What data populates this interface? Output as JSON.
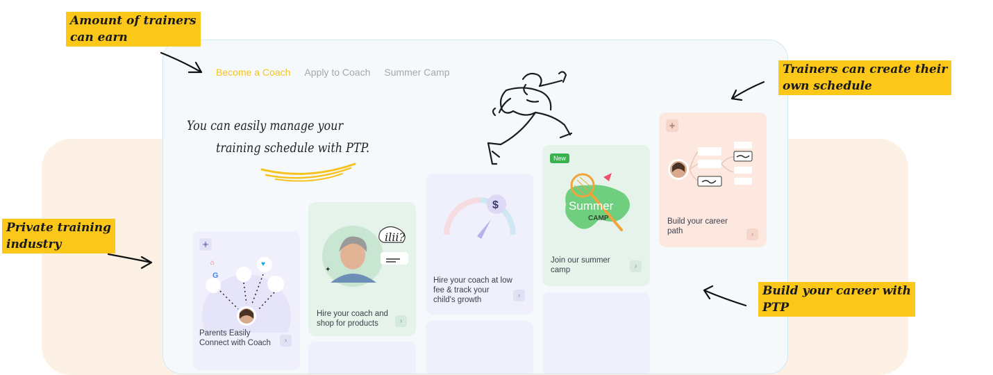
{
  "nav": {
    "items": [
      {
        "label": "Become a Coach",
        "active": true
      },
      {
        "label": "Apply to Coach",
        "active": false
      },
      {
        "label": "Summer Camp",
        "active": false
      }
    ]
  },
  "hero": {
    "line1": "You can easily manage your",
    "line2": "training schedule with PTP."
  },
  "cards": {
    "connect": {
      "label_line1": "Parents Easily",
      "label_line2": "Connect with Coach"
    },
    "shop": {
      "label_line1": "Hire your coach and",
      "label_line2": "shop for products"
    },
    "growth": {
      "label_line1": "Hire your coach at low",
      "label_line2": "fee & track your",
      "label_line3": "child's growth"
    },
    "camp": {
      "badge": "New",
      "logo_line1": "Summer",
      "logo_line2": "CAMP",
      "label_line1": "Join our summer",
      "label_line2": "camp"
    },
    "career": {
      "label_line1": "Build your career",
      "label_line2": "path"
    }
  },
  "annotations": {
    "earn_line1": "Amount of trainers",
    "earn_line2": "can earn",
    "schedule_line1": "Trainers can create their",
    "schedule_line2": "own schedule",
    "industry_line1": "Private training",
    "industry_line2": "industry",
    "career_line1": "Build your career with",
    "career_line2": "PTP"
  },
  "colors": {
    "accent_yellow": "#fbc81a",
    "nav_active": "#f4c21f",
    "card_lavender": "#f0effc",
    "card_green": "#e6f3ea",
    "card_peach": "#fde8df",
    "background_peach": "#fdf1e6"
  },
  "icons": [
    "sparkle-icon",
    "google-icon",
    "airbnb-icon",
    "twitter-icon",
    "dollar-icon",
    "badminton-racket-icon",
    "shuttlecock-icon",
    "chevron-right-icon",
    "arrow-icon"
  ]
}
